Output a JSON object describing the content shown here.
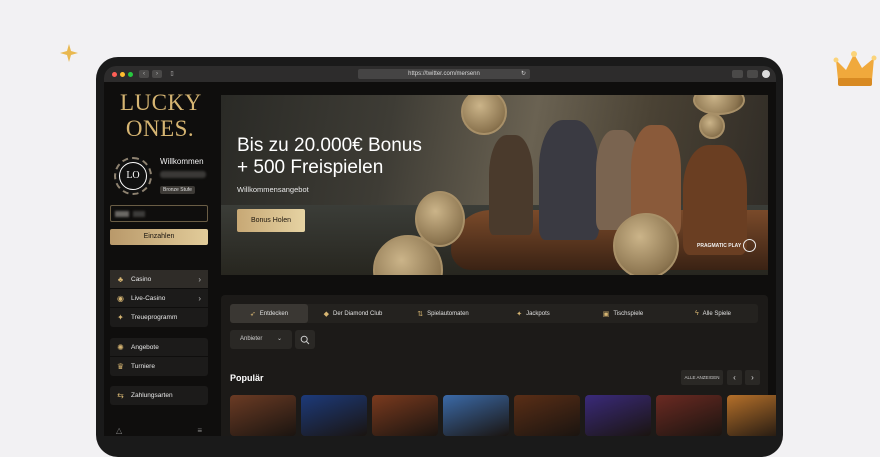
{
  "browser": {
    "url": "https://twitter.com/mersenn"
  },
  "sidebar": {
    "logo_line1": "LUCKY",
    "logo_line2": "ONES.",
    "avatar_initials": "LO",
    "welcome": "Willkommen",
    "tier_badge": "Bronze Stufe",
    "deposit_label": "Einzahlen",
    "group1": [
      {
        "label": "Casino",
        "icon": "cherries-icon"
      },
      {
        "label": "Live-Casino",
        "icon": "live-chip-icon"
      },
      {
        "label": "Treueprogramm",
        "icon": "star-burst-icon"
      }
    ],
    "group2": [
      {
        "label": "Angebote",
        "icon": "party-popper-icon"
      },
      {
        "label": "Turniere",
        "icon": "trophy-icon"
      }
    ],
    "group3": [
      {
        "label": "Zahlungsarten",
        "icon": "transfer-arrows-icon"
      }
    ]
  },
  "hero": {
    "title_line1": "Bis zu 20.000€ Bonus",
    "title_line2": "+ 500 Freispielen",
    "subtitle": "Willkommensangebot",
    "cta": "Bonus Holen",
    "provider_logo": "PRAGMATIC PLAY"
  },
  "lobby": {
    "tabs": [
      {
        "label": "Entdecken",
        "icon": "rocket-icon",
        "active": true
      },
      {
        "label": "Der Diamond Club",
        "icon": "diamond-icon",
        "active": false
      },
      {
        "label": "Spielautomaten",
        "icon": "slot-icon",
        "active": false
      },
      {
        "label": "Jackpots",
        "icon": "sparkle-icon",
        "active": false
      },
      {
        "label": "Tischspiele",
        "icon": "dice-icon",
        "active": false
      },
      {
        "label": "Alle Spiele",
        "icon": "lightning-icon",
        "active": false
      }
    ],
    "provider_filter": "Anbieter",
    "popular_heading": "Populär",
    "all_button": "ALLE ANZEIGEN",
    "games": [
      {
        "theme": "#6b3b24"
      },
      {
        "theme": "#1c3a7a"
      },
      {
        "theme": "#7a3a1e"
      },
      {
        "theme": "#3b6aa8"
      },
      {
        "theme": "#5a2e16"
      },
      {
        "theme": "#3a2a7a"
      },
      {
        "theme": "#6b2a22"
      },
      {
        "theme": "#b5702a"
      }
    ]
  },
  "colors": {
    "accent_gold": "#d6b572",
    "background": "#0f0e0d"
  }
}
